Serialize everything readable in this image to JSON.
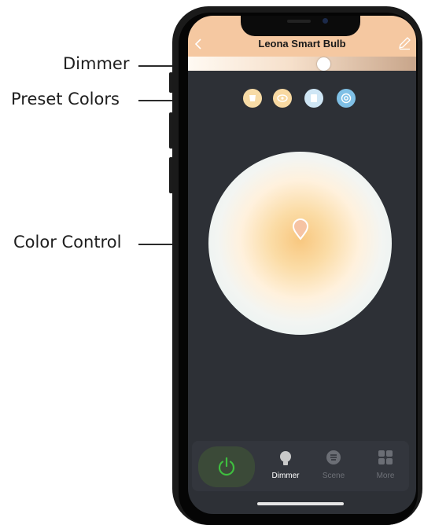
{
  "annotations": {
    "dimmer": "Dimmer",
    "preset_colors": "Preset Colors",
    "color_control": "Color Control"
  },
  "app": {
    "title": "Leona Smart Bulb",
    "header_color": "#f5c8a1",
    "back_icon": "chevron-left-icon",
    "edit_icon": "pencil-icon"
  },
  "dimmer": {
    "level": 0.6
  },
  "presets": [
    {
      "icon": "cup-icon",
      "color": "#f7dba6"
    },
    {
      "icon": "eye-icon",
      "color": "#f8d9a2"
    },
    {
      "icon": "book-icon",
      "color": "#cfe6f5"
    },
    {
      "icon": "target-icon",
      "color": "#7fc0e6"
    }
  ],
  "bottom_bar": {
    "power": {
      "icon": "power-icon",
      "color": "#3fbf3f"
    },
    "tabs": [
      {
        "label": "Dimmer",
        "icon": "bulb-icon",
        "active": true
      },
      {
        "label": "Scene",
        "icon": "scene-icon",
        "active": false
      },
      {
        "label": "More",
        "icon": "grid-icon",
        "active": false
      }
    ]
  }
}
